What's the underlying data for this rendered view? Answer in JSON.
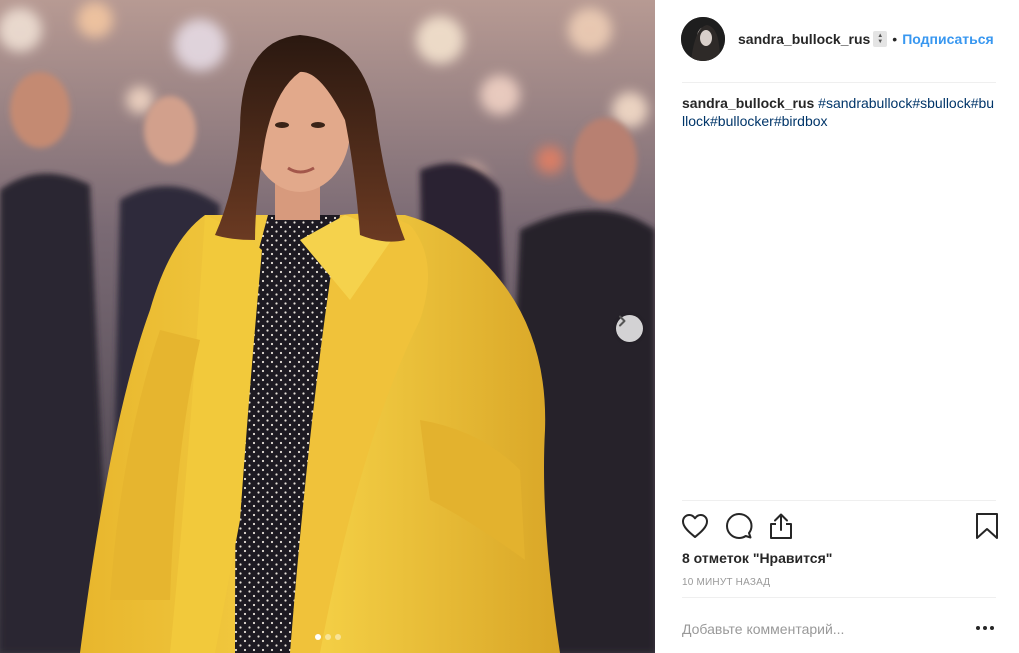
{
  "post": {
    "username": "sandra_bullock_rus",
    "separator": "•",
    "follow_label": "Подписаться",
    "caption": {
      "author": "sandra_bullock_rus",
      "hashtags": "#sandrabullock#sbullock#bullock#bullocker#birdbox"
    },
    "likes_text": "8 отметок \"Нравится\"",
    "timestamp": "10 МИНУТ НАЗАД",
    "comment_placeholder": "Добавьте комментарий..."
  },
  "carousel": {
    "current": 1,
    "total": 3
  },
  "icons": {
    "like": "heart-icon",
    "comment": "comment-icon",
    "share": "share-icon",
    "save": "bookmark-icon",
    "next": "chevron-right-icon",
    "more": "more-options-icon"
  },
  "colors": {
    "link": "#3897f0",
    "hashtag": "#003569",
    "muted": "#999999",
    "text": "#262626"
  }
}
